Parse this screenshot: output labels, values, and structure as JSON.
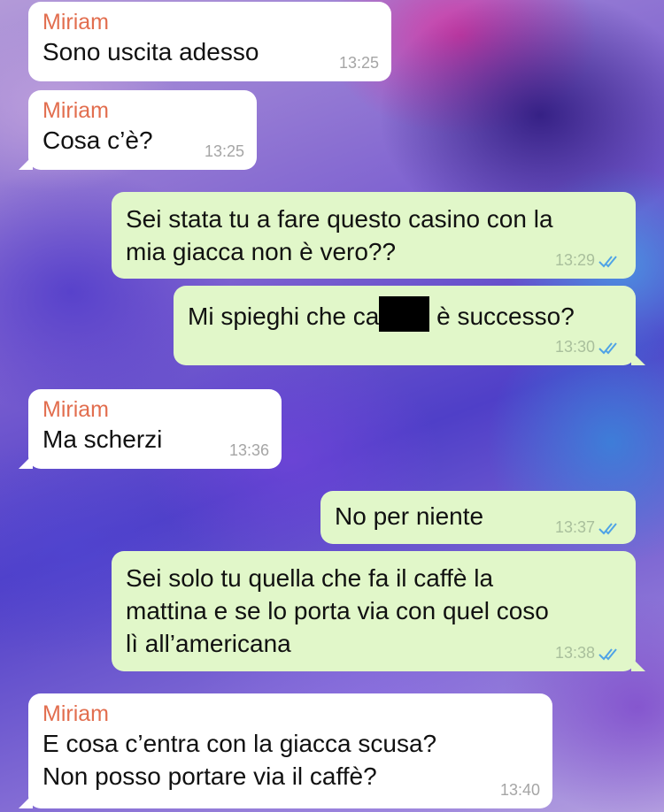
{
  "colors": {
    "incoming_bubble": "#ffffff",
    "outgoing_bubble": "#e1f7c9",
    "sender_name": "#e26e4f",
    "read_ticks": "#4fa3e6",
    "timestamp": "#a5a5a5"
  },
  "messages": [
    {
      "direction": "in",
      "sender": "Miriam",
      "text": "Sono uscita adesso",
      "time": "13:25"
    },
    {
      "direction": "in",
      "sender": "Miriam",
      "text": "Cosa c’è?",
      "time": "13:25"
    },
    {
      "direction": "out",
      "lines": [
        "Sei stata tu a fare questo casino con la",
        "mia giacca non è vero??"
      ],
      "time": "13:29",
      "status_icon": "double-check-icon"
    },
    {
      "direction": "out",
      "text_before": "Mi spieghi che ca",
      "text_after": " è successo?",
      "time": "13:30",
      "status_icon": "double-check-icon"
    },
    {
      "direction": "in",
      "sender": "Miriam",
      "text": "Ma scherzi",
      "time": "13:36"
    },
    {
      "direction": "out",
      "text": "No per niente",
      "time": "13:37",
      "status_icon": "double-check-icon"
    },
    {
      "direction": "out",
      "lines": [
        "Sei solo tu quella che fa il caffè la",
        "mattina e se lo porta via con quel coso",
        "lì all’americana"
      ],
      "time": "13:38",
      "status_icon": "double-check-icon"
    },
    {
      "direction": "in",
      "sender": "Miriam",
      "lines": [
        "E cosa c’entra con la giacca scusa?",
        "Non posso portare via il caffè?"
      ],
      "time": "13:40"
    }
  ]
}
